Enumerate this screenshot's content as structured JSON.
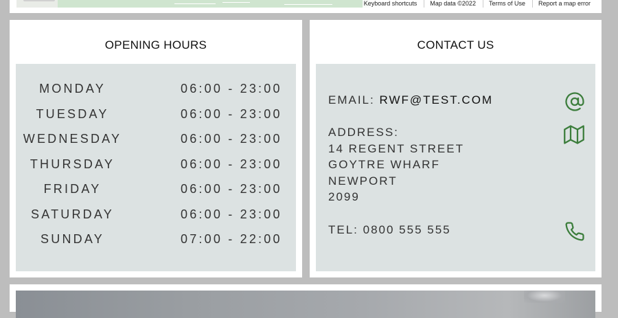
{
  "map": {
    "attribution": [
      "Keyboard shortcuts",
      "Map data ©2022",
      "Terms of Use",
      "Report a map error"
    ]
  },
  "opening_hours": {
    "title": "OPENING HOURS",
    "rows": [
      {
        "day": "MONDAY",
        "time": "06:00 - 23:00"
      },
      {
        "day": "TUESDAY",
        "time": "06:00 - 23:00"
      },
      {
        "day": "WEDNESDAY",
        "time": "06:00 - 23:00"
      },
      {
        "day": "THURSDAY",
        "time": "06:00 - 23:00"
      },
      {
        "day": "FRIDAY",
        "time": "06:00 - 23:00"
      },
      {
        "day": "SATURDAY",
        "time": "06:00 - 23:00"
      },
      {
        "day": "SUNDAY",
        "time": "07:00 - 22:00"
      }
    ]
  },
  "contact": {
    "title": "CONTACT US",
    "email_label": "EMAIL:",
    "email_value": "RWF@TEST.COM",
    "address_label": "ADDRESS:",
    "address_lines": [
      "14 REGENT STREET",
      "GOYTRE WHARF",
      "NEWPORT",
      "2099"
    ],
    "tel_label": "TEL:",
    "tel_value": "0800 555 555",
    "icons": {
      "email": "at-icon",
      "address": "map-icon",
      "phone": "phone-icon"
    },
    "icon_color": "#3b7d3b"
  },
  "colors": {
    "page_background": "#bdbdbd",
    "panel_background": "#dce2e2"
  }
}
